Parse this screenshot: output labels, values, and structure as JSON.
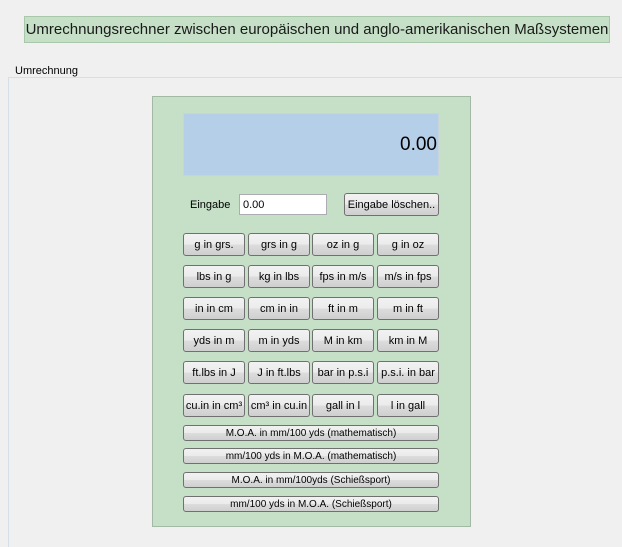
{
  "header": {
    "title": "Umrechnungsrechner zwischen europäischen und anglo-amerikanischen Maßsystemen"
  },
  "group": {
    "legend": "Umrechnung"
  },
  "display": {
    "value": "0.00"
  },
  "input": {
    "label": "Eingabe",
    "value": "0.00",
    "clear_label": "Eingabe löschen.."
  },
  "grid": [
    [
      "g in grs.",
      "grs in g",
      "oz in g",
      "g in oz"
    ],
    [
      "lbs in g",
      "kg in lbs",
      "fps in m/s",
      "m/s in fps"
    ],
    [
      "in in cm",
      "cm in in",
      "ft in m",
      "m in ft"
    ],
    [
      "yds in m",
      "m in yds",
      "M in km",
      "km in M"
    ],
    [
      "ft.lbs in J",
      "J in ft.lbs",
      "bar in p.s.i",
      "p.s.i. in bar"
    ],
    [
      "cu.in in cm³",
      "cm³ in cu.in",
      "gall in l",
      "l in gall"
    ]
  ],
  "wide_buttons": [
    "M.O.A. in mm/100 yds (mathematisch)",
    "mm/100 yds in M.O.A. (mathematisch)",
    "M.O.A. in mm/100yds (Schießsport)",
    "mm/100 yds in M.O.A. (Schießsport)"
  ]
}
